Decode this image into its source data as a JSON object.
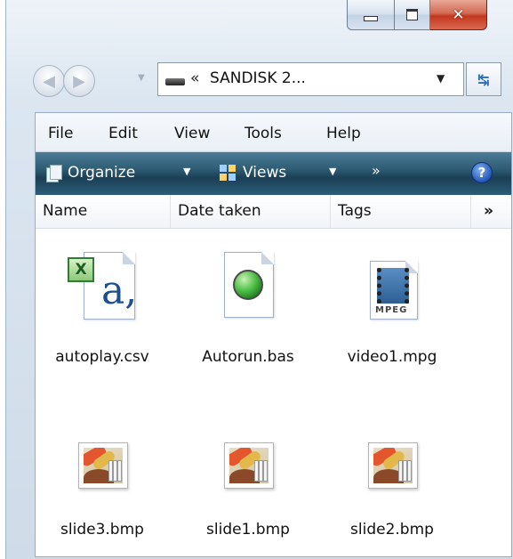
{
  "window": {
    "address": {
      "separator": "«",
      "text": "SANDISK 2..."
    }
  },
  "menu": [
    "File",
    "Edit",
    "View",
    "Tools",
    "Help"
  ],
  "toolbar": {
    "organize_label": "Organize",
    "views_label": "Views",
    "more_label": "»",
    "help_label": "?"
  },
  "columns": {
    "name": "Name",
    "date_taken": "Date taken",
    "tags": "Tags",
    "more": "»"
  },
  "files": [
    {
      "name": "autoplay.csv",
      "icon": "excel-csv-icon"
    },
    {
      "name": "Autorun.bas",
      "icon": "bas-file-icon"
    },
    {
      "name": "video1.mpg",
      "icon": "mpeg-video-icon"
    },
    {
      "name": "slide3.bmp",
      "icon": "bmp-image-icon"
    },
    {
      "name": "slide1.bmp",
      "icon": "bmp-image-icon"
    },
    {
      "name": "slide2.bmp",
      "icon": "bmp-image-icon"
    }
  ],
  "icons": {
    "mpeg_caption": "MPEG",
    "csv_glyph": "a,",
    "excel_glyph": "X"
  },
  "colors": {
    "command_bar": "#2d5c74",
    "close_button": "#c4371f",
    "accent_blue": "#2456b8"
  }
}
